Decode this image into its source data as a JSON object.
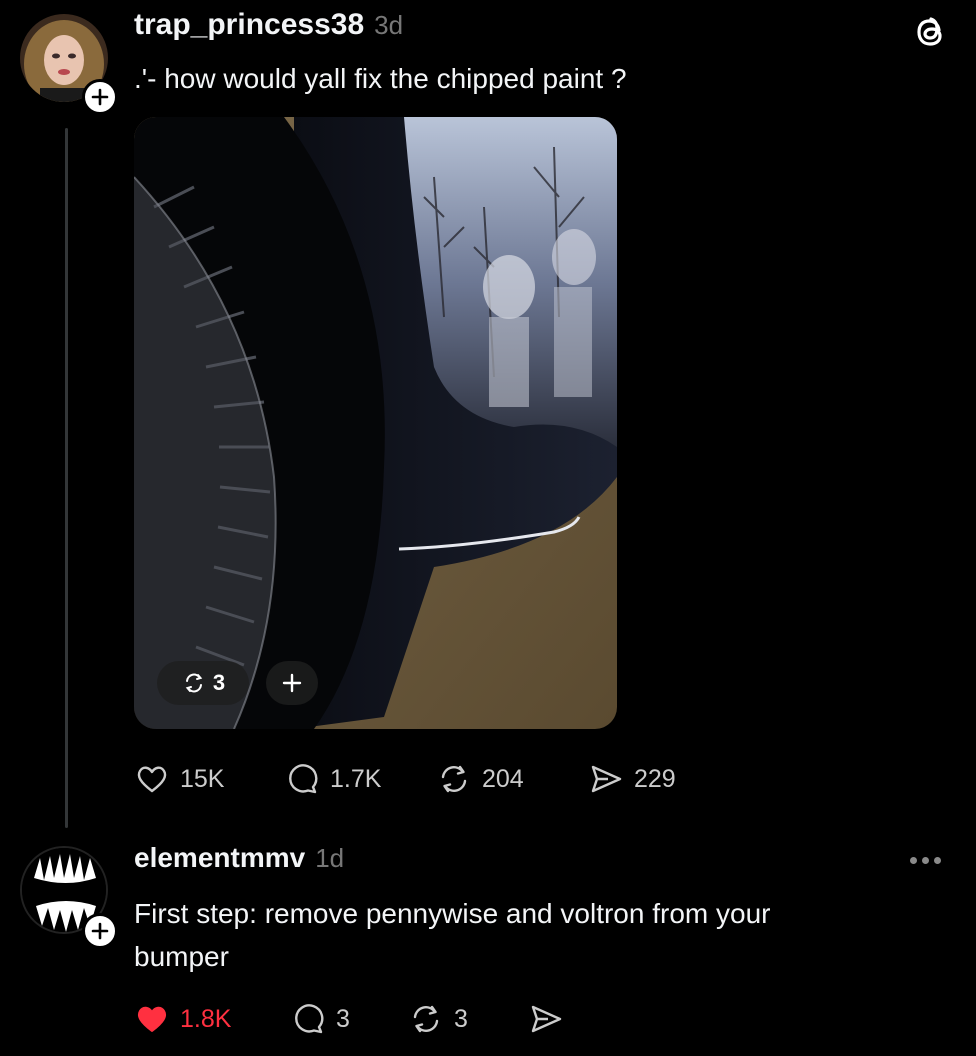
{
  "post": {
    "username": "trap_princess38",
    "time": "3d",
    "text": ".'- how would yall fix the chipped paint ?",
    "media_repost_count": "3",
    "stats": {
      "likes": "15K",
      "comments": "1.7K",
      "reposts": "204",
      "shares": "229"
    }
  },
  "reply": {
    "username": "elementmmv",
    "time": "1d",
    "text_line1": "First step: remove pennywise and voltron from your",
    "text_line2": "bumper",
    "stats": {
      "likes": "1.8K",
      "liked": true,
      "comments": "3",
      "reposts": "3"
    }
  },
  "colors": {
    "background": "#000000",
    "text": "#f3f5f7",
    "muted": "#777777",
    "like_red": "#ff3040"
  },
  "icons": [
    "threads-logo-icon",
    "plus-icon",
    "heart-icon",
    "comment-icon",
    "repost-icon",
    "share-icon",
    "more-icon"
  ]
}
